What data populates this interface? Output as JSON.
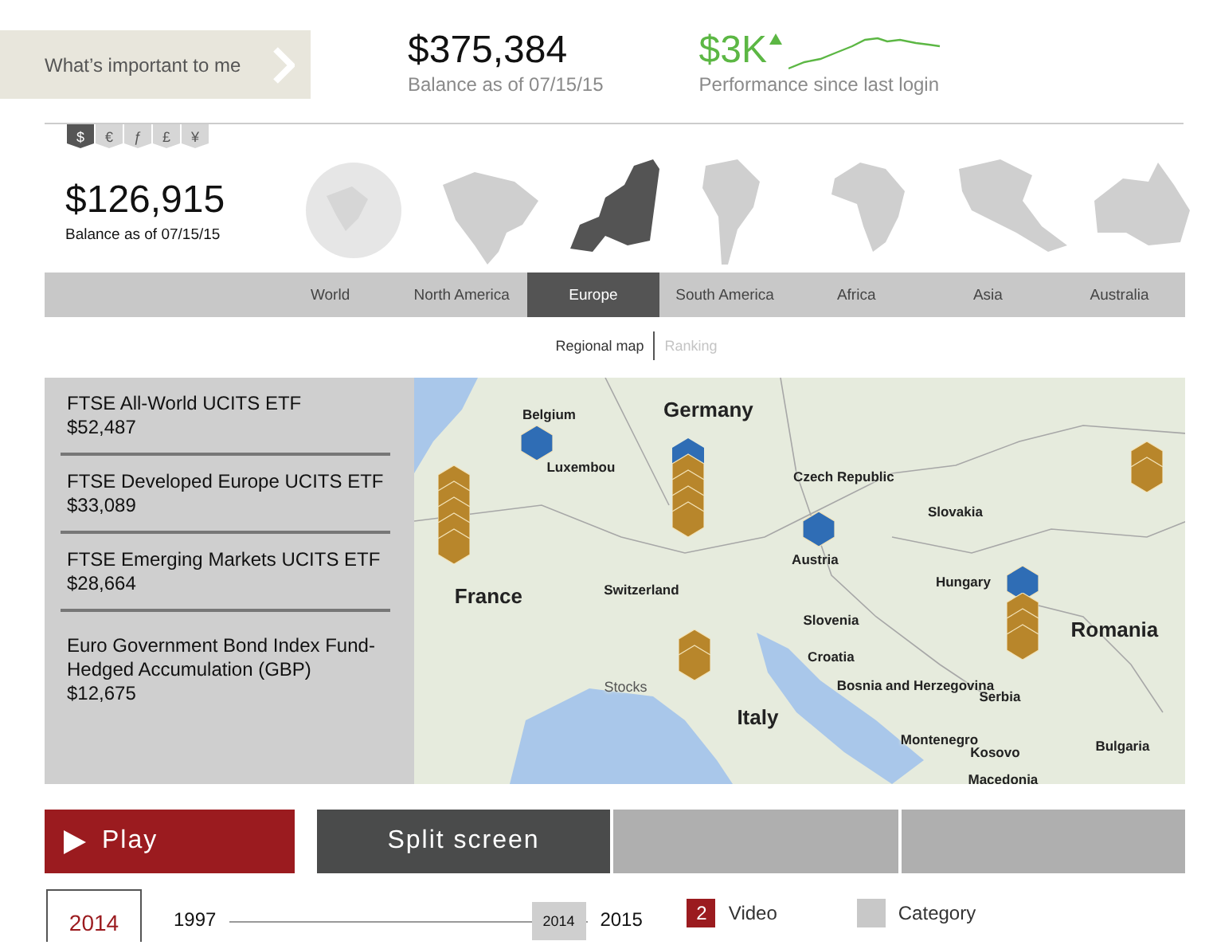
{
  "header": {
    "cta": "What’s important to me",
    "balance": "$375,384",
    "balance_caption": "Balance as of 07/15/15",
    "performance": "$3K",
    "performance_caption": "Performance since last login"
  },
  "currencies": [
    {
      "label": "$",
      "selected": true
    },
    {
      "label": "€",
      "selected": false
    },
    {
      "label": "ƒ",
      "selected": false
    },
    {
      "label": "£",
      "selected": false
    },
    {
      "label": "¥",
      "selected": false
    }
  ],
  "region_balance": {
    "amount": "$126,915",
    "caption": "Balance as of 07/15/15"
  },
  "regions": [
    {
      "label": "World",
      "kind": "globe",
      "selected": false
    },
    {
      "label": "North America",
      "kind": "north-america",
      "selected": false
    },
    {
      "label": "Europe",
      "kind": "europe",
      "selected": true
    },
    {
      "label": "South America",
      "kind": "south-america",
      "selected": false
    },
    {
      "label": "Africa",
      "kind": "africa",
      "selected": false
    },
    {
      "label": "Asia",
      "kind": "asia",
      "selected": false
    },
    {
      "label": "Australia",
      "kind": "australia",
      "selected": false
    }
  ],
  "views": [
    {
      "label": "Regional map",
      "selected": true
    },
    {
      "label": "Ranking",
      "selected": false
    }
  ],
  "funds": [
    {
      "name": "FTSE All-World UCITS ETF",
      "value": "$52,487"
    },
    {
      "name": "FTSE Developed Europe UCITS ETF",
      "value": "$33,089"
    },
    {
      "name": "FTSE Emerging Markets UCITS ETF",
      "value": "$28,664"
    },
    {
      "name": "Euro Government Bond Index Fund-Hedged Accumulation (GBP)",
      "value": "$12,675"
    }
  ],
  "map": {
    "labels": [
      {
        "text": "Belgium",
        "kind": "place"
      },
      {
        "text": "Germany",
        "kind": "country"
      },
      {
        "text": "Luxembou",
        "kind": "place"
      },
      {
        "text": "Czech Republic",
        "kind": "place"
      },
      {
        "text": "Slovakia",
        "kind": "place"
      },
      {
        "text": "Austria",
        "kind": "place"
      },
      {
        "text": "Hungary",
        "kind": "place"
      },
      {
        "text": "France",
        "kind": "country"
      },
      {
        "text": "Switzerland",
        "kind": "place"
      },
      {
        "text": "Slovenia",
        "kind": "place"
      },
      {
        "text": "Romania",
        "kind": "country"
      },
      {
        "text": "Croatia",
        "kind": "place"
      },
      {
        "text": "Stocks",
        "kind": "legend"
      },
      {
        "text": "Bosnia and Herzegovina",
        "kind": "place"
      },
      {
        "text": "Serbia",
        "kind": "place"
      },
      {
        "text": "Italy",
        "kind": "country"
      },
      {
        "text": "Montenegro",
        "kind": "place"
      },
      {
        "text": "Kosovo",
        "kind": "place"
      },
      {
        "text": "Bulgaria",
        "kind": "place"
      },
      {
        "text": "Macedonia",
        "kind": "place"
      }
    ]
  },
  "controls": {
    "play": "Play",
    "split": "Split screen"
  },
  "timeline": {
    "current": "2014",
    "start": "1997",
    "end": "2015",
    "thumb": "2014",
    "level": 0.92
  },
  "legend": [
    {
      "badge": "2",
      "label": "Video",
      "color": "#9b1b1f"
    },
    {
      "label": "Category",
      "color": "#c8c8c8"
    }
  ]
}
